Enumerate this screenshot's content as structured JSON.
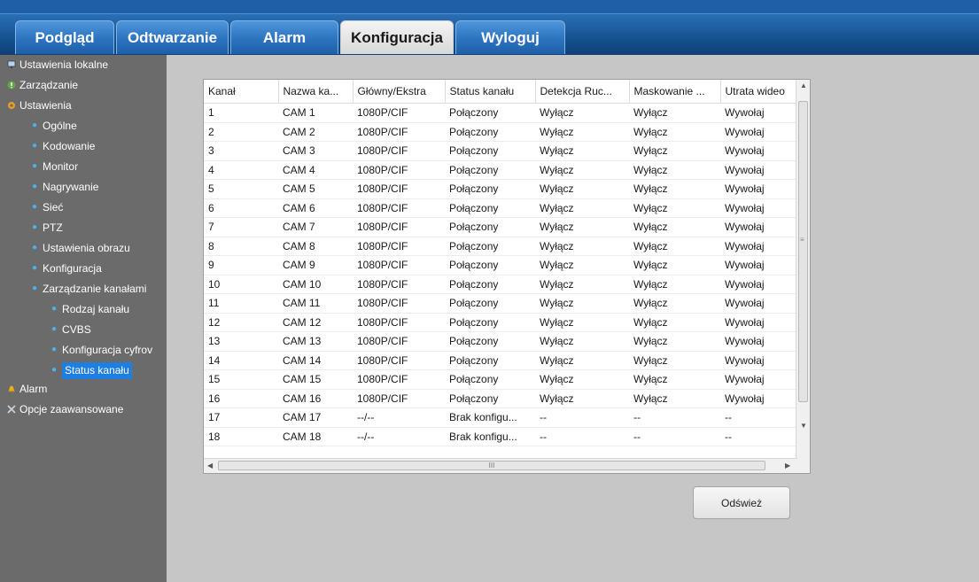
{
  "nav": {
    "tabs": [
      {
        "label": "Podgląd"
      },
      {
        "label": "Odtwarzanie"
      },
      {
        "label": "Alarm"
      },
      {
        "label": "Konfiguracja"
      },
      {
        "label": "Wyloguj"
      }
    ],
    "active_tab": "Konfiguracja"
  },
  "sidebar": {
    "items": [
      {
        "label": "Ustawienia lokalne",
        "icon": "monitor-icon"
      },
      {
        "label": "Zarządzanie",
        "icon": "info-icon"
      },
      {
        "label": "Ustawienia",
        "icon": "gear-icon"
      },
      {
        "label": "Ogólne"
      },
      {
        "label": "Kodowanie"
      },
      {
        "label": "Monitor"
      },
      {
        "label": "Nagrywanie"
      },
      {
        "label": "Sieć"
      },
      {
        "label": "PTZ"
      },
      {
        "label": "Ustawienia obrazu"
      },
      {
        "label": "Konfiguracja"
      },
      {
        "label": "Zarządzanie kanałami"
      },
      {
        "label": "Rodzaj kanału"
      },
      {
        "label": "CVBS"
      },
      {
        "label": "Konfiguracja cyfrov"
      },
      {
        "label": "Status kanału"
      },
      {
        "label": "Alarm",
        "icon": "bell-icon"
      },
      {
        "label": "Opcje zaawansowane",
        "icon": "tools-icon"
      }
    ],
    "selected": "Status kanału"
  },
  "table": {
    "headers": [
      "Kanał",
      "Nazwa ka...",
      "Główny/Ekstra",
      "Status kanału",
      "Detekcja Ruc...",
      "Maskowanie ...",
      "Utrata wideo"
    ],
    "rows": [
      [
        "1",
        "CAM 1",
        "1080P/CIF",
        "Połączony",
        "Wyłącz",
        "Wyłącz",
        "Wywołaj"
      ],
      [
        "2",
        "CAM 2",
        "1080P/CIF",
        "Połączony",
        "Wyłącz",
        "Wyłącz",
        "Wywołaj"
      ],
      [
        "3",
        "CAM 3",
        "1080P/CIF",
        "Połączony",
        "Wyłącz",
        "Wyłącz",
        "Wywołaj"
      ],
      [
        "4",
        "CAM 4",
        "1080P/CIF",
        "Połączony",
        "Wyłącz",
        "Wyłącz",
        "Wywołaj"
      ],
      [
        "5",
        "CAM 5",
        "1080P/CIF",
        "Połączony",
        "Wyłącz",
        "Wyłącz",
        "Wywołaj"
      ],
      [
        "6",
        "CAM 6",
        "1080P/CIF",
        "Połączony",
        "Wyłącz",
        "Wyłącz",
        "Wywołaj"
      ],
      [
        "7",
        "CAM 7",
        "1080P/CIF",
        "Połączony",
        "Wyłącz",
        "Wyłącz",
        "Wywołaj"
      ],
      [
        "8",
        "CAM 8",
        "1080P/CIF",
        "Połączony",
        "Wyłącz",
        "Wyłącz",
        "Wywołaj"
      ],
      [
        "9",
        "CAM 9",
        "1080P/CIF",
        "Połączony",
        "Wyłącz",
        "Wyłącz",
        "Wywołaj"
      ],
      [
        "10",
        "CAM 10",
        "1080P/CIF",
        "Połączony",
        "Wyłącz",
        "Wyłącz",
        "Wywołaj"
      ],
      [
        "11",
        "CAM 11",
        "1080P/CIF",
        "Połączony",
        "Wyłącz",
        "Wyłącz",
        "Wywołaj"
      ],
      [
        "12",
        "CAM 12",
        "1080P/CIF",
        "Połączony",
        "Wyłącz",
        "Wyłącz",
        "Wywołaj"
      ],
      [
        "13",
        "CAM 13",
        "1080P/CIF",
        "Połączony",
        "Wyłącz",
        "Wyłącz",
        "Wywołaj"
      ],
      [
        "14",
        "CAM 14",
        "1080P/CIF",
        "Połączony",
        "Wyłącz",
        "Wyłącz",
        "Wywołaj"
      ],
      [
        "15",
        "CAM 15",
        "1080P/CIF",
        "Połączony",
        "Wyłącz",
        "Wyłącz",
        "Wywołaj"
      ],
      [
        "16",
        "CAM 16",
        "1080P/CIF",
        "Połączony",
        "Wyłącz",
        "Wyłącz",
        "Wywołaj"
      ],
      [
        "17",
        "CAM 17",
        "--/--",
        "Brak konfigu...",
        "--",
        "--",
        "--"
      ],
      [
        "18",
        "CAM 18",
        "--/--",
        "Brak konfigu...",
        "--",
        "--",
        "--"
      ]
    ]
  },
  "scroll": {
    "h_thumb_glyph": "III"
  },
  "buttons": {
    "refresh": "Odśwież"
  },
  "colors": {
    "nav_blue": "#1f5fa8",
    "sidebar": "#6b6b6b",
    "selection": "#1e7fe0",
    "content_bg": "#c6c6c6"
  }
}
